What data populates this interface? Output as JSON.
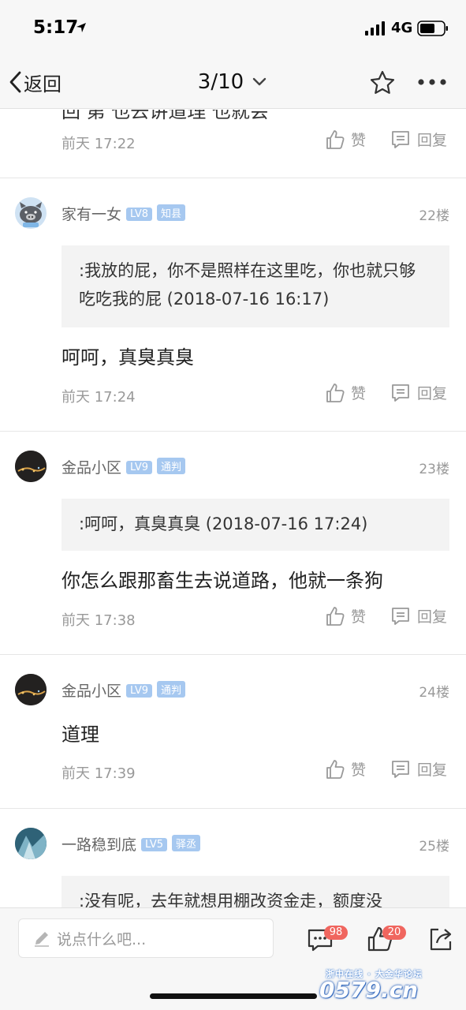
{
  "status_bar": {
    "time": "5:17",
    "network": "4G"
  },
  "nav": {
    "back_label": "返回",
    "page_indicator": "3/10"
  },
  "partial_top": {
    "text": "回 第 也去讲道理 也就会"
  },
  "posts": [
    {
      "time": "前天 17:22",
      "like_label": "赞",
      "reply_label": "回复"
    },
    {
      "username": "家有一女",
      "level": "LV8",
      "title": "知县",
      "floor": "22楼",
      "quote": ":我放的屁，你不是照样在这里吃，你也就只够吃吃我的屁 (2018-07-16 16:17)",
      "content": "呵呵，真臭真臭",
      "time": "前天 17:24",
      "like_label": "赞",
      "reply_label": "回复"
    },
    {
      "username": "金品小区",
      "level": "LV9",
      "title": "通判",
      "floor": "23楼",
      "quote": ":呵呵，真臭真臭 (2018-07-16 17:24)",
      "content": "你怎么跟那畜生去说道路，他就一条狗",
      "time": "前天 17:38",
      "like_label": "赞",
      "reply_label": "回复"
    },
    {
      "username": "金品小区",
      "level": "LV9",
      "title": "通判",
      "floor": "24楼",
      "content": "道理",
      "time": "前天 17:39",
      "like_label": "赞",
      "reply_label": "回复"
    },
    {
      "username": "一路稳到底",
      "level": "LV5",
      "title": "驿丞",
      "floor": "25楼",
      "quote": ":没有呢，去年就想用棚改资金走，额度没"
    }
  ],
  "bottom_bar": {
    "compose_placeholder": "说点什么吧...",
    "comment_count": "98",
    "like_count": "20"
  },
  "watermark": {
    "top_text": "浙中在线 · 大金华论坛",
    "main_text": "0579.cn"
  },
  "colors": {
    "badge": "#a6c8f0",
    "count_badge": "#f0665f",
    "muted": "#999999"
  }
}
